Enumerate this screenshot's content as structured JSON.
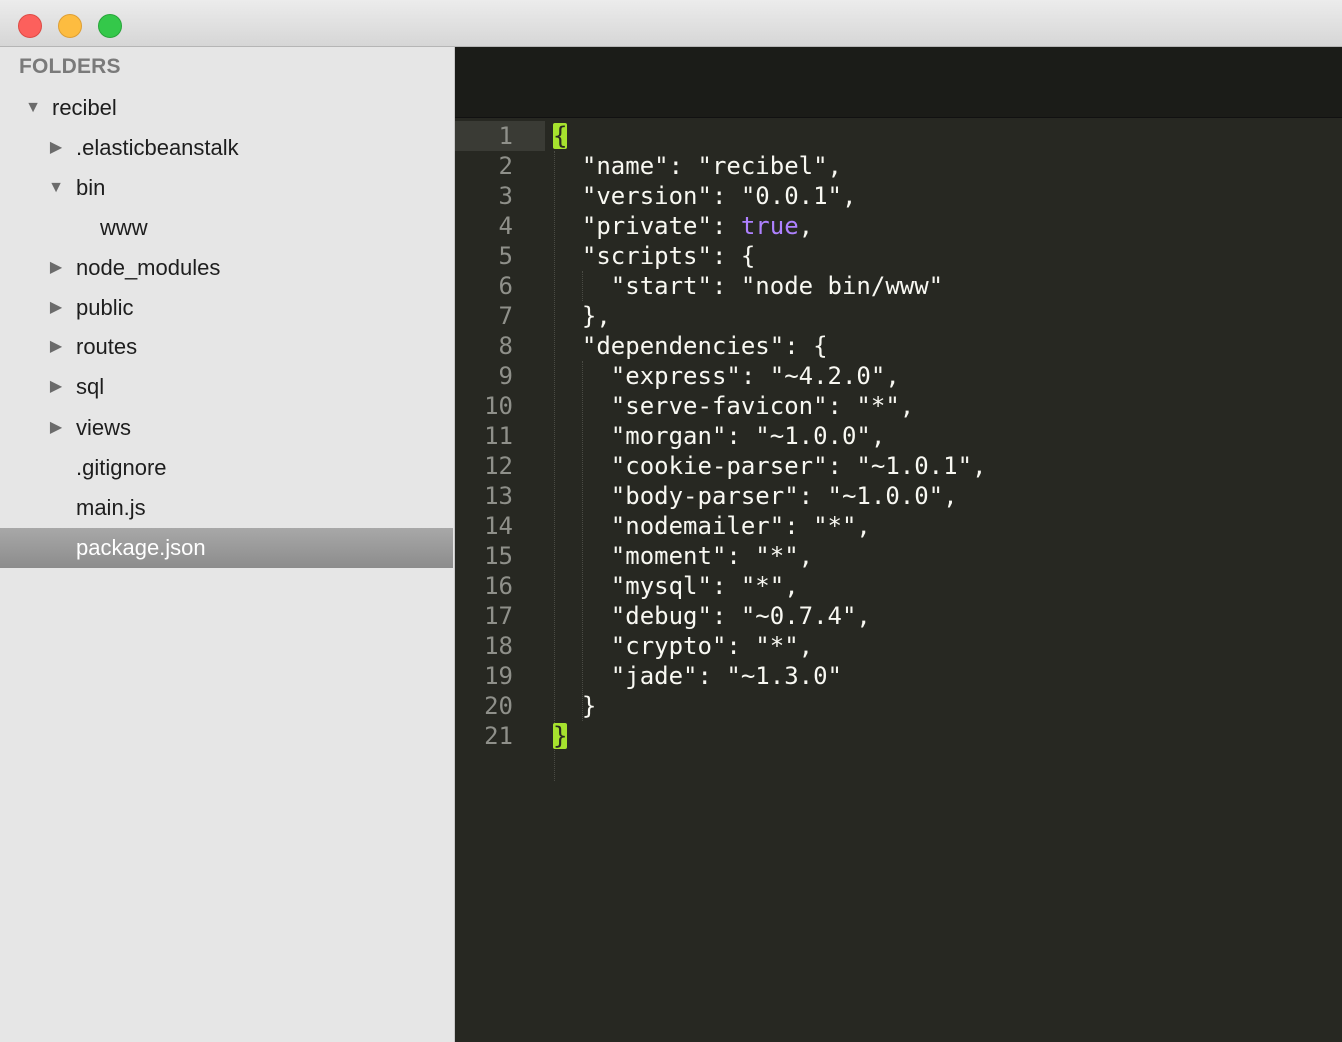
{
  "window": {
    "traffic_lights": [
      "close",
      "minimize",
      "maximize"
    ]
  },
  "sidebar": {
    "header": "FOLDERS",
    "items": [
      {
        "label": "recibel",
        "expanded": true,
        "type": "folder"
      },
      {
        "label": ".elasticbeanstalk",
        "expanded": false,
        "type": "folder"
      },
      {
        "label": "bin",
        "expanded": true,
        "type": "folder"
      },
      {
        "label": "www",
        "type": "file"
      },
      {
        "label": "node_modules",
        "expanded": false,
        "type": "folder"
      },
      {
        "label": "public",
        "expanded": false,
        "type": "folder"
      },
      {
        "label": "routes",
        "expanded": false,
        "type": "folder"
      },
      {
        "label": "sql",
        "expanded": false,
        "type": "folder"
      },
      {
        "label": "views",
        "expanded": false,
        "type": "folder"
      },
      {
        "label": ".gitignore",
        "type": "file"
      },
      {
        "label": "main.js",
        "type": "file"
      },
      {
        "label": "package.json",
        "type": "file",
        "selected": true
      }
    ]
  },
  "editor": {
    "file": "package.json",
    "lines": [
      {
        "num": "1",
        "text": "{"
      },
      {
        "num": "2",
        "text": "  \"name\": \"recibel\","
      },
      {
        "num": "3",
        "text": "  \"version\": \"0.0.1\","
      },
      {
        "num": "4",
        "text": "  \"private\": true,"
      },
      {
        "num": "5",
        "text": "  \"scripts\": {"
      },
      {
        "num": "6",
        "text": "    \"start\": \"node bin/www\""
      },
      {
        "num": "7",
        "text": "  },"
      },
      {
        "num": "8",
        "text": "  \"dependencies\": {"
      },
      {
        "num": "9",
        "text": "    \"express\": \"~4.2.0\","
      },
      {
        "num": "10",
        "text": "    \"serve-favicon\": \"*\","
      },
      {
        "num": "11",
        "text": "    \"morgan\": \"~1.0.0\","
      },
      {
        "num": "12",
        "text": "    \"cookie-parser\": \"~1.0.1\","
      },
      {
        "num": "13",
        "text": "    \"body-parser\": \"~1.0.0\","
      },
      {
        "num": "14",
        "text": "    \"nodemailer\": \"*\","
      },
      {
        "num": "15",
        "text": "    \"moment\": \"*\","
      },
      {
        "num": "16",
        "text": "    \"mysql\": \"*\","
      },
      {
        "num": "17",
        "text": "    \"debug\": \"~0.7.4\","
      },
      {
        "num": "18",
        "text": "    \"crypto\": \"*\","
      },
      {
        "num": "19",
        "text": "    \"jade\": \"~1.3.0\""
      },
      {
        "num": "20",
        "text": "  }"
      },
      {
        "num": "21",
        "text": "}"
      }
    ],
    "active_line": "1",
    "colors": {
      "background": "#272822",
      "text": "#f8f8f2",
      "keyword": "#ae81ff",
      "bracket_match": "#a6e22e",
      "line_number": "#8f908a"
    }
  }
}
